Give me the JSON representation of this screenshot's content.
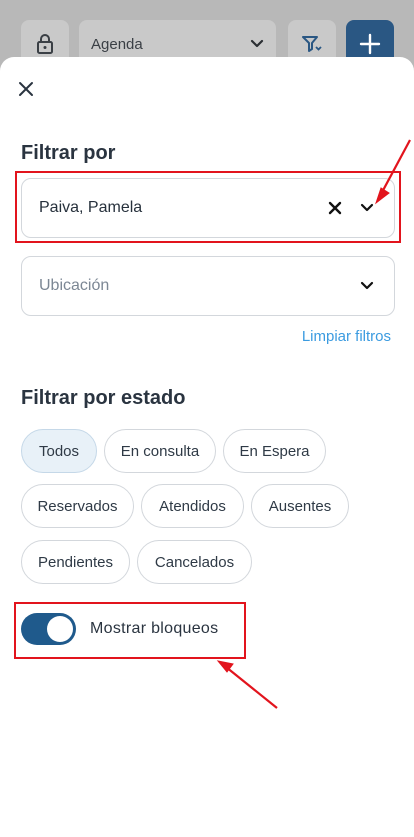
{
  "topbar": {
    "agenda_select": "Agenda"
  },
  "sheet": {
    "filter_title": "Filtrar por",
    "professional_value": "Paiva, Pamela",
    "location_placeholder": "Ubicación",
    "clear_filters": "Limpiar filtros",
    "state_title": "Filtrar por estado",
    "states": [
      "Todos",
      "En consulta",
      "En Espera",
      "Reservados",
      "Atendidos",
      "Ausentes",
      "Pendientes",
      "Cancelados"
    ],
    "selected_state": "Todos",
    "show_blocks_label": "Mostrar bloqueos",
    "show_blocks_enabled": true
  },
  "colors": {
    "accent": "#1f5a8c",
    "link": "#3b9be0",
    "annotation": "#e2141d"
  },
  "icons": [
    "lock-icon",
    "chevron-down-icon",
    "filter-icon",
    "plus-icon",
    "close-icon",
    "clear-icon"
  ]
}
